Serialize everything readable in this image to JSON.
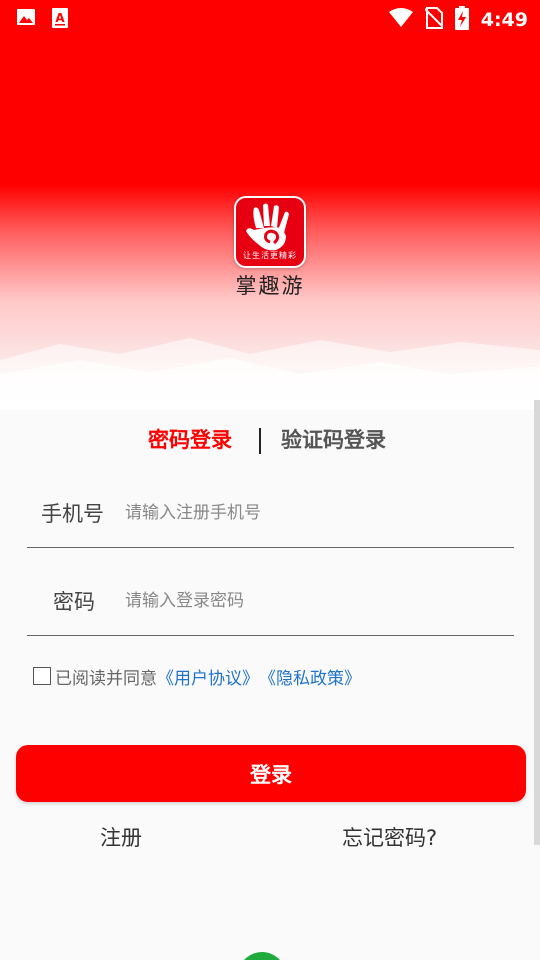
{
  "status_bar": {
    "time": "4:49",
    "left_icons": [
      "image-icon",
      "a-font-icon"
    ],
    "right_icons": [
      "wifi-icon",
      "no-sim-icon",
      "battery-charging-icon"
    ]
  },
  "header": {
    "logo_slogan": "让生活更精彩",
    "app_name": "掌趣游"
  },
  "tabs": {
    "password_login": "密码登录",
    "divider": "|",
    "code_login": "验证码登录",
    "active": "password_login"
  },
  "form": {
    "phone_label": "手机号",
    "phone_placeholder": "请输入注册手机号",
    "phone_value": "",
    "password_label": "密码",
    "password_placeholder": "请输入登录密码",
    "password_value": ""
  },
  "agreement": {
    "checked": false,
    "text": "已阅读并同意",
    "user_agreement": "《用户协议》",
    "privacy_policy": "《隐私政策》"
  },
  "login_button": "登录",
  "links": {
    "register": "注册",
    "forgot_password": "忘记密码?"
  },
  "colors": {
    "primary": "#ff0000",
    "link": "#1f73c9",
    "background": "#fafafa",
    "logo_bg": "#e60012"
  }
}
